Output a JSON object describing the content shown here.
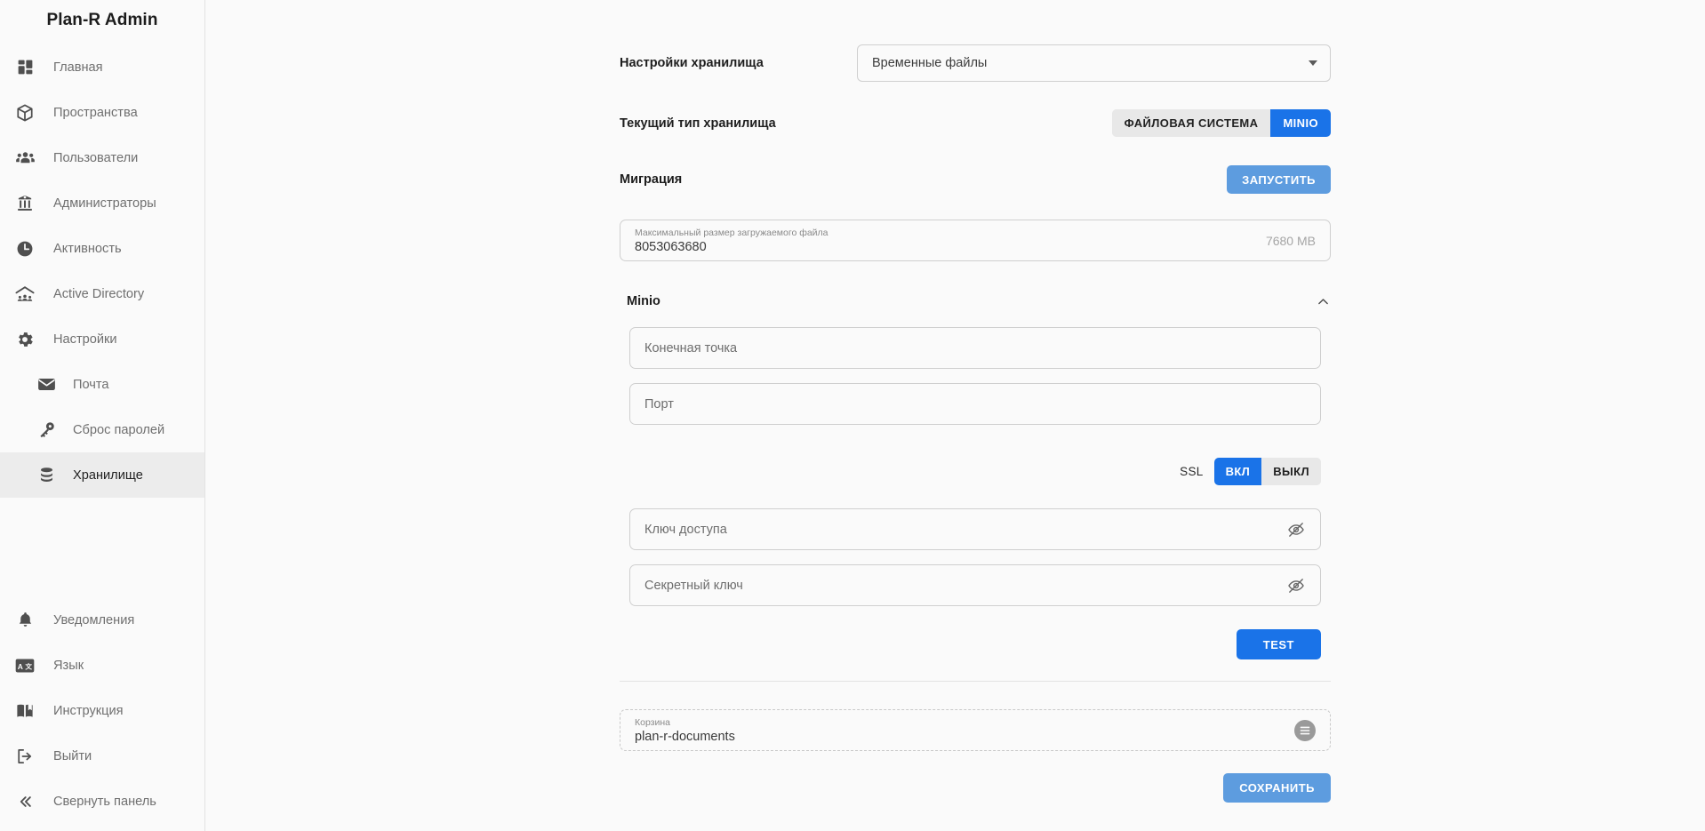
{
  "sidebar": {
    "brand": "Plan-R Admin",
    "items": [
      {
        "label": "Главная",
        "icon": "dashboard-icon",
        "sub": false,
        "active": false
      },
      {
        "label": "Пространства",
        "icon": "cube-icon",
        "sub": false,
        "active": false
      },
      {
        "label": "Пользователи",
        "icon": "users-icon",
        "sub": false,
        "active": false
      },
      {
        "label": "Администраторы",
        "icon": "admin-icon",
        "sub": false,
        "active": false
      },
      {
        "label": "Активность",
        "icon": "clock-icon",
        "sub": false,
        "active": false
      },
      {
        "label": "Active Directory",
        "icon": "active-directory-icon",
        "sub": false,
        "active": false
      },
      {
        "label": "Настройки",
        "icon": "gear-icon",
        "sub": false,
        "active": false
      },
      {
        "label": "Почта",
        "icon": "mail-icon",
        "sub": true,
        "active": false
      },
      {
        "label": "Сброс паролей",
        "icon": "key-icon",
        "sub": true,
        "active": false
      },
      {
        "label": "Хранилище",
        "icon": "database-icon",
        "sub": true,
        "active": true
      }
    ],
    "bottom_items": [
      {
        "label": "Уведомления",
        "icon": "bell-icon"
      },
      {
        "label": "Язык",
        "icon": "translate-icon"
      },
      {
        "label": "Инструкция",
        "icon": "book-icon"
      },
      {
        "label": "Выйти",
        "icon": "logout-icon"
      },
      {
        "label": "Свернуть панель",
        "icon": "chevron-double-left-icon"
      }
    ]
  },
  "main": {
    "storage_settings": {
      "label": "Настройки хранилища",
      "selected_option": "Временные файлы"
    },
    "current_storage_type": {
      "label": "Текущий тип хранилища",
      "options": [
        {
          "label": "ФАЙЛОВАЯ СИСТЕМА",
          "selected": false
        },
        {
          "label": "MINIO",
          "selected": true
        }
      ]
    },
    "migration": {
      "label": "Миграция",
      "button": "ЗАПУСТИТЬ"
    },
    "max_upload": {
      "mini_label": "Максимальный размер загружаемого файла",
      "value": "8053063680",
      "suffix": "7680 MB"
    },
    "minio": {
      "title": "Minio",
      "expanded": true,
      "endpoint_placeholder": "Конечная точка",
      "port_placeholder": "Порт",
      "ssl": {
        "label": "SSL",
        "options": [
          {
            "label": "ВКЛ",
            "selected": true
          },
          {
            "label": "ВЫКЛ",
            "selected": false
          }
        ]
      },
      "access_key_placeholder": "Ключ доступа",
      "secret_key_placeholder": "Секретный ключ",
      "test_button": "TEST"
    },
    "bucket": {
      "mini_label": "Корзина",
      "value": "plan-r-documents"
    },
    "save_button": "СОХРАНИТЬ"
  },
  "colors": {
    "accent_strong": "#1a73e8",
    "accent_light": "#5d9cdf",
    "sidebar_bg": "#fafafa",
    "active_item_bg": "#ececec",
    "text_primary": "#1e1e1e",
    "text_muted": "#6f6f6f"
  }
}
